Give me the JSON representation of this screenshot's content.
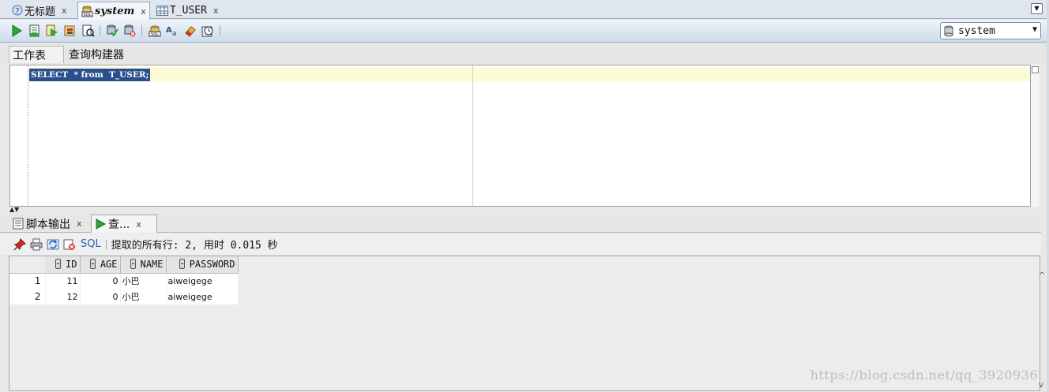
{
  "tabs": [
    {
      "label": "无标题",
      "close": "x",
      "icon": "help-circle-icon"
    },
    {
      "label": "system",
      "close": "x",
      "icon": "sql-worksheet-icon"
    },
    {
      "label": "T_USER",
      "close": "x",
      "icon": "table-icon"
    }
  ],
  "toolbar": {
    "connection": "system"
  },
  "editor_tabs": {
    "worksheet": "工作表",
    "query_builder": "查询构建器"
  },
  "editor": {
    "sql": "SELECT  * from  T_USER;"
  },
  "output_tabs": {
    "script_output": "脚本输出",
    "query_result": "查...",
    "close": "x"
  },
  "result_toolbar": {
    "sql_label": "SQL",
    "status": "提取的所有行: 2, 用时 0.015 秒"
  },
  "grid": {
    "columns": [
      "ID",
      "AGE",
      "NAME",
      "PASSWORD"
    ],
    "rows": [
      {
        "n": "1",
        "ID": "11",
        "AGE": "0",
        "NAME": "小巴",
        "PASSWORD": "aiweigege"
      },
      {
        "n": "2",
        "ID": "12",
        "AGE": "0",
        "NAME": "小巴",
        "PASSWORD": "aiweigege"
      }
    ]
  },
  "watermark": "https://blog.csdn.net/qq_3920936",
  "colors": {
    "selection": "#2a4f8c",
    "current_line": "#fbfbd8",
    "toolbar": "#cfdceb",
    "sql_link": "#2b5fb3"
  }
}
